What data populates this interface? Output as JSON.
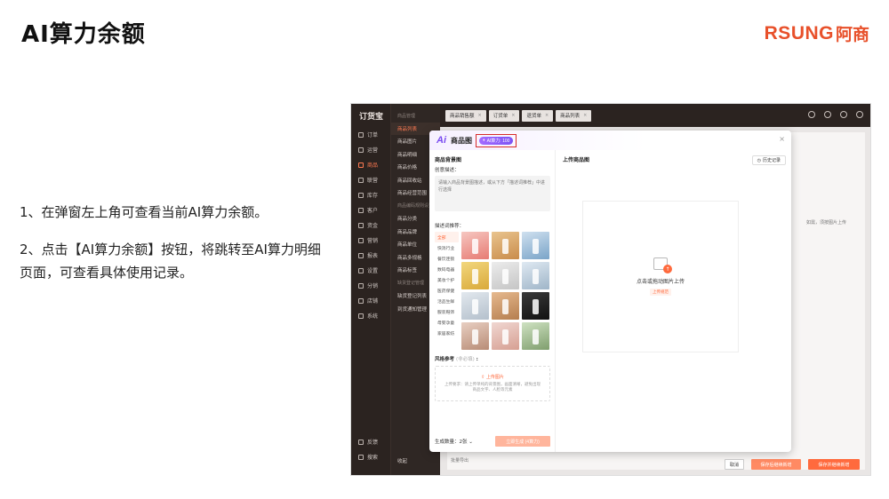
{
  "slide": {
    "title": "AI算力余额",
    "logo_latin": "RSUNG",
    "logo_cn": "阿商",
    "steps": [
      "1、在弹窗左上角可查看当前AI算力余额。",
      "2、点击【AI算力余额】按钮，将跳转至AI算力明细页面，可查看具体使用记录。"
    ]
  },
  "app": {
    "brand": "订货宝",
    "nav": [
      "订单",
      "运营",
      "商品",
      "联营",
      "库存",
      "客户",
      "资金",
      "营销",
      "报表",
      "设置",
      "分销",
      "店铺",
      "系统"
    ],
    "nav_bottom": [
      "反馈",
      "搜索"
    ],
    "subnav_group": "商品管理",
    "subnav": [
      "商品列表",
      "商品图片",
      "商品明细",
      "商品价格",
      "商品回收站",
      "商品经营范围",
      "商品编码规则设置",
      "商品分类",
      "商品品牌",
      "商品单位",
      "商品多规格",
      "商品标签",
      "缺货登记管理",
      "缺货登记列表",
      "到货通知管理"
    ],
    "subnav_foot": "收起",
    "tabs": [
      "商品销售额",
      "订货单",
      "退货单",
      "商品列表"
    ],
    "bg_buttons": [
      "取消",
      "保存后继续新增",
      "保存并继续新增"
    ],
    "bg_text": "批量导出",
    "bg_hint": "如需，须按图片上传"
  },
  "modal": {
    "ai_logo": "Ai",
    "title": "商品图",
    "ai_balance_label": "AI算力: 100",
    "close": "×",
    "left": {
      "section": "商品背景图",
      "desc_label": "创意描述：",
      "desc_placeholder": "请输入商品背景图描述，或从下方「描述词推荐」中进行选择",
      "prompt_label": "描述词推荐：",
      "categories": [
        "全部",
        "快消行业",
        "餐饮连锁",
        "数码电器",
        "美妆个护",
        "医药保健",
        "活品生鲜",
        "服装鞋饰",
        "母婴孕童",
        "家居家纺"
      ],
      "style_label": "风格参考",
      "style_optional": "(非必填)",
      "upload_link": "上传图片",
      "upload_hint": "上传要求：请上传单纯的背景图，画面清晰，避免出现商品文字、人脸等元素",
      "count_label": "生成数量：",
      "count_value": "2张",
      "generate_button": "立即生成 (4算力)"
    },
    "right": {
      "section": "上传商品图",
      "history_button": "历史记录",
      "drop_text": "点击或拖动图片上传",
      "drop_tag": "上传规范"
    }
  },
  "colors": {
    "accent": "#ff6a3d",
    "brand_logo": "#e8502a",
    "ai_purple": "#7b52f5",
    "highlight_box": "#d62b2b",
    "nav_bg": "#2b2320"
  },
  "thumb_colors": [
    [
      "#f6c7c1",
      "#e77b73"
    ],
    [
      "#e9c48e",
      "#c98c4b"
    ],
    [
      "#cfe0ef",
      "#7aa4c8"
    ],
    [
      "#f2d77d",
      "#d9a93a"
    ],
    [
      "#ececec",
      "#c5c5c5"
    ],
    [
      "#dfe9f2",
      "#9fb5c8"
    ],
    [
      "#e2e8ee",
      "#b4c0cc"
    ],
    [
      "#e6b98e",
      "#b57e4f"
    ],
    [
      "#3a3a3a",
      "#111111"
    ],
    [
      "#e8cfc2",
      "#b88c76"
    ],
    [
      "#f0d7d2",
      "#d69f92"
    ],
    [
      "#cfe2c3",
      "#7f9e6d"
    ]
  ]
}
